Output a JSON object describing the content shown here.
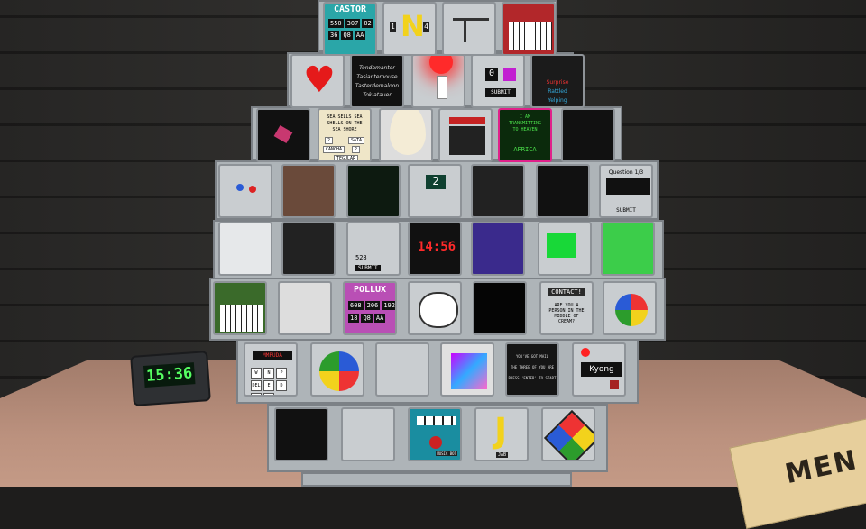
{
  "scene": {
    "type": "bomb-defusal"
  },
  "alarm_clock": {
    "time": "15:36"
  },
  "manual": {
    "label": "MEN"
  },
  "modules": {
    "castor": {
      "title": "CASTOR",
      "nums": [
        "550",
        "307",
        "02",
        "36",
        "Q8",
        "AA"
      ]
    },
    "letter_n": {
      "letter": "N",
      "side_digits": [
        "1",
        "4"
      ]
    },
    "keypad_submit": {
      "display": "0",
      "button": "SUBMIT"
    },
    "tasks": {
      "items": [
        "Surprise",
        "Rattled",
        "Yelping"
      ]
    },
    "poem": {
      "lines": [
        "Tendamanter",
        "Tasiantemouse",
        "Tasterdemaloon",
        "Toklatauer"
      ]
    },
    "sea_shells": {
      "lines": [
        "SEA SELLS SEA",
        "SHELLS ON THE",
        "SEA SHORE"
      ],
      "buttons": [
        "2",
        "SATA",
        "CANCHA",
        "2",
        "TEGULAR"
      ]
    },
    "transmit": {
      "lines": [
        "I AM",
        "TRANSMITTING",
        "TO HEAVEN"
      ],
      "answer": "AFRICA"
    },
    "question": {
      "header": "Question 1/3",
      "button": "SUBMIT"
    },
    "number_display": {
      "value": "2"
    },
    "pizza": {
      "value": "528",
      "button": "SUBMIT"
    },
    "timer_display": {
      "value": "14:56"
    },
    "pollux": {
      "title": "POLLUX",
      "nums": [
        "608",
        "206",
        "192",
        "18",
        "Q8",
        "AA"
      ]
    },
    "contact": {
      "title": "CONTACT!",
      "text": "ARE YOU A PERSON IN THE MIDDLE OF CREAM?"
    },
    "wordle": {
      "display": "MMPUDA",
      "keys": [
        "W",
        "N",
        "P",
        "DEL",
        "E",
        "D",
        "A",
        "OK"
      ]
    },
    "kyong": {
      "name": "Kyong"
    },
    "press_start": {
      "lines": [
        "YOU'VE GOT MAIL",
        "THE THREE OF YOU ARE",
        "PRESS 'ENTER' TO START"
      ]
    },
    "pinball": {
      "label": "MUSIC BOT"
    },
    "letter_j": {
      "letter": "J",
      "sub": "JAB"
    }
  }
}
